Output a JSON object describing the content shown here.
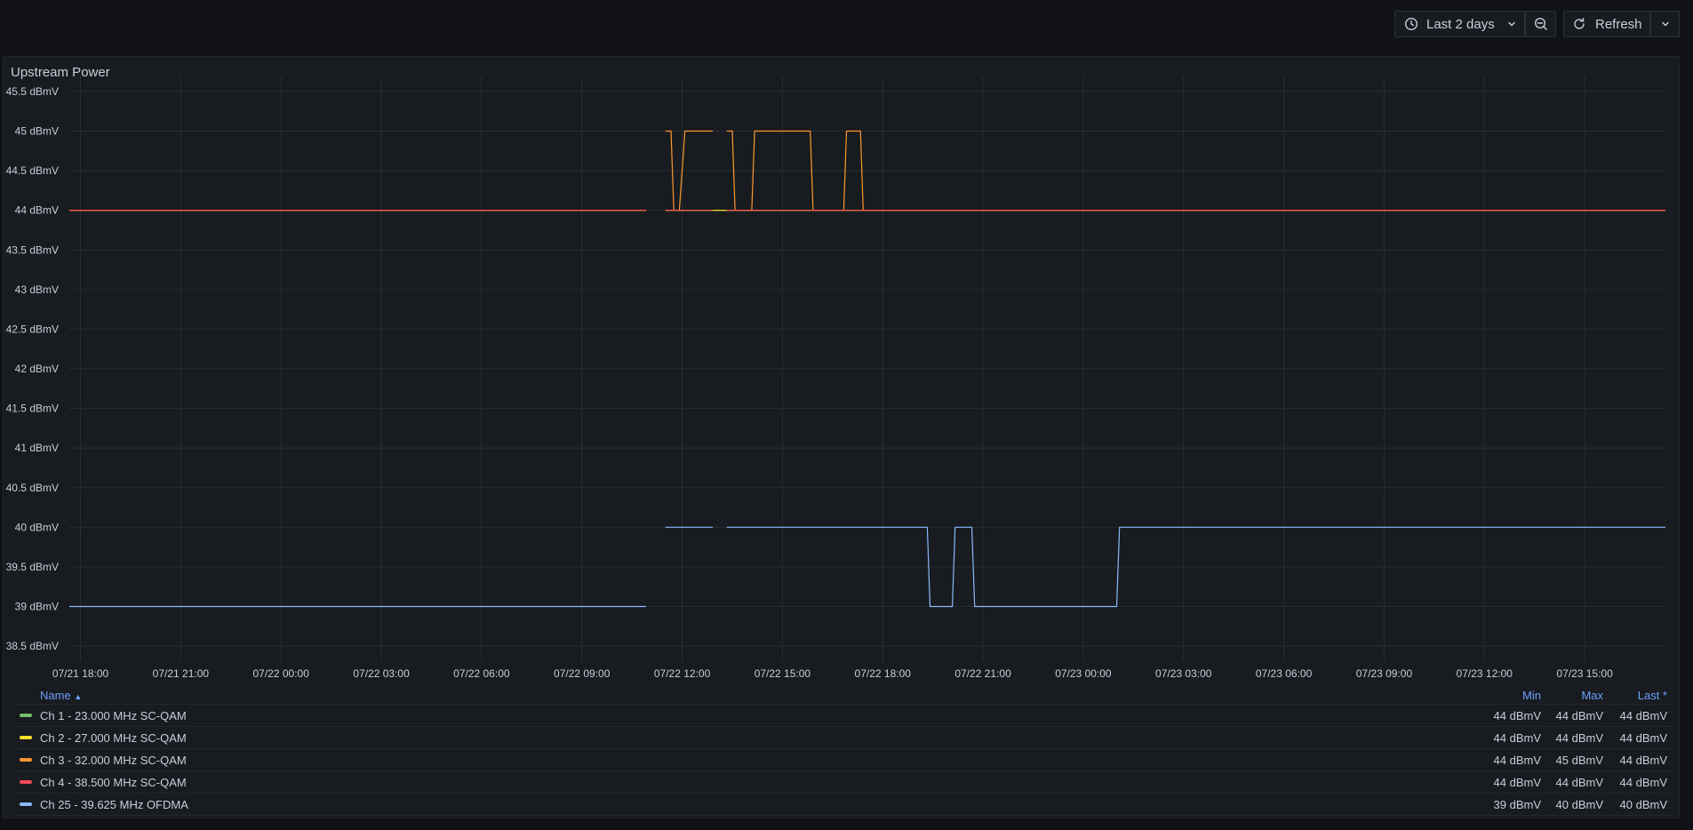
{
  "toolbar": {
    "time_range_label": "Last 2 days",
    "refresh_label": "Refresh",
    "icons": [
      "clock-icon",
      "chevron-down-icon",
      "zoom-out-icon",
      "refresh-icon",
      "chevron-down-icon"
    ]
  },
  "panel": {
    "title": "Upstream Power"
  },
  "chart_data": {
    "type": "line",
    "title": "Upstream Power",
    "unit": "dBmV",
    "y_ticks": [
      "45.5 dBmV",
      "45 dBmV",
      "44.5 dBmV",
      "44 dBmV",
      "43.5 dBmV",
      "43 dBmV",
      "42.5 dBmV",
      "42 dBmV",
      "41.5 dBmV",
      "41 dBmV",
      "40.5 dBmV",
      "40 dBmV",
      "39.5 dBmV",
      "39 dBmV",
      "38.5 dBmV"
    ],
    "ylim": [
      38.4,
      45.6
    ],
    "x_ticks": [
      "07/21 18:00",
      "07/21 21:00",
      "07/22 00:00",
      "07/22 03:00",
      "07/22 06:00",
      "07/22 09:00",
      "07/22 12:00",
      "07/22 15:00",
      "07/22 18:00",
      "07/22 21:00",
      "07/23 00:00",
      "07/23 03:00",
      "07/23 06:00",
      "07/23 09:00",
      "07/23 12:00",
      "07/23 15:00"
    ],
    "xlim": [
      "07/21 17:40",
      "07/23 17:25"
    ],
    "grid": true,
    "legend_position": "bottom",
    "series": [
      {
        "name": "Ch 1 - 23.000 MHz SC-QAM",
        "color": "#73bf69",
        "points": [
          [
            "07/21 17:40",
            44
          ],
          [
            "07/22 10:55",
            44
          ],
          null,
          [
            "07/22 11:30",
            44
          ],
          [
            "07/23 17:25",
            44
          ]
        ]
      },
      {
        "name": "Ch 2 - 27.000 MHz SC-QAM",
        "color": "#fade2a",
        "points": [
          [
            "07/21 17:40",
            44
          ],
          [
            "07/22 10:55",
            44
          ],
          null,
          [
            "07/22 11:30",
            44
          ],
          [
            "07/23 17:25",
            44
          ]
        ]
      },
      {
        "name": "Ch 3 - 32.000 MHz SC-QAM",
        "color": "#ff9830",
        "points": [
          [
            "07/21 17:40",
            44
          ],
          [
            "07/22 10:55",
            44
          ],
          null,
          [
            "07/22 11:30",
            45
          ],
          [
            "07/22 11:40",
            45
          ],
          [
            "07/22 11:45",
            44
          ],
          [
            "07/22 11:55",
            44
          ],
          [
            "07/22 12:05",
            45
          ],
          [
            "07/22 12:55",
            45
          ],
          null,
          [
            "07/22 13:20",
            45
          ],
          [
            "07/22 13:30",
            45
          ],
          [
            "07/22 13:35",
            44
          ],
          [
            "07/22 14:05",
            44
          ],
          [
            "07/22 14:10",
            45
          ],
          [
            "07/22 15:50",
            45
          ],
          [
            "07/22 15:55",
            44
          ],
          [
            "07/22 16:50",
            44
          ],
          [
            "07/22 16:55",
            45
          ],
          [
            "07/22 17:20",
            45
          ],
          [
            "07/22 17:25",
            44
          ],
          [
            "07/23 17:25",
            44
          ]
        ]
      },
      {
        "name": "Ch 4 - 38.500 MHz SC-QAM",
        "color": "#f2495c",
        "points": [
          [
            "07/21 17:40",
            44
          ],
          [
            "07/22 10:55",
            44
          ],
          null,
          [
            "07/22 11:30",
            44
          ],
          [
            "07/22 12:55",
            44
          ],
          null,
          [
            "07/22 13:20",
            44
          ],
          [
            "07/23 17:25",
            44
          ]
        ]
      },
      {
        "name": "Ch 25 - 39.625 MHz OFDMA",
        "color": "#8ab8ff",
        "points": [
          [
            "07/21 17:40",
            39
          ],
          [
            "07/22 10:55",
            39
          ],
          null,
          [
            "07/22 11:30",
            40
          ],
          [
            "07/22 12:55",
            40
          ],
          null,
          [
            "07/22 13:20",
            40
          ],
          [
            "07/22 19:20",
            40
          ],
          [
            "07/22 19:25",
            39
          ],
          [
            "07/22 20:05",
            39
          ],
          [
            "07/22 20:10",
            40
          ],
          [
            "07/22 20:40",
            40
          ],
          [
            "07/22 20:45",
            39
          ],
          [
            "07/23 01:00",
            39
          ],
          [
            "07/23 01:05",
            40
          ],
          [
            "07/23 17:25",
            40
          ]
        ]
      }
    ]
  },
  "legend": {
    "headers": {
      "name": "Name",
      "min": "Min",
      "max": "Max",
      "last": "Last *"
    },
    "sort_indicator": "^",
    "rows": [
      {
        "name": "Ch 1 - 23.000 MHz SC-QAM",
        "color": "#73bf69",
        "min": "44 dBmV",
        "max": "44 dBmV",
        "last": "44 dBmV"
      },
      {
        "name": "Ch 2 - 27.000 MHz SC-QAM",
        "color": "#fade2a",
        "min": "44 dBmV",
        "max": "44 dBmV",
        "last": "44 dBmV"
      },
      {
        "name": "Ch 3 - 32.000 MHz SC-QAM",
        "color": "#ff9830",
        "min": "44 dBmV",
        "max": "45 dBmV",
        "last": "44 dBmV"
      },
      {
        "name": "Ch 4 - 38.500 MHz SC-QAM",
        "color": "#f2495c",
        "min": "44 dBmV",
        "max": "44 dBmV",
        "last": "44 dBmV"
      },
      {
        "name": "Ch 25 - 39.625 MHz OFDMA",
        "color": "#8ab8ff",
        "min": "39 dBmV",
        "max": "40 dBmV",
        "last": "40 dBmV"
      }
    ]
  }
}
